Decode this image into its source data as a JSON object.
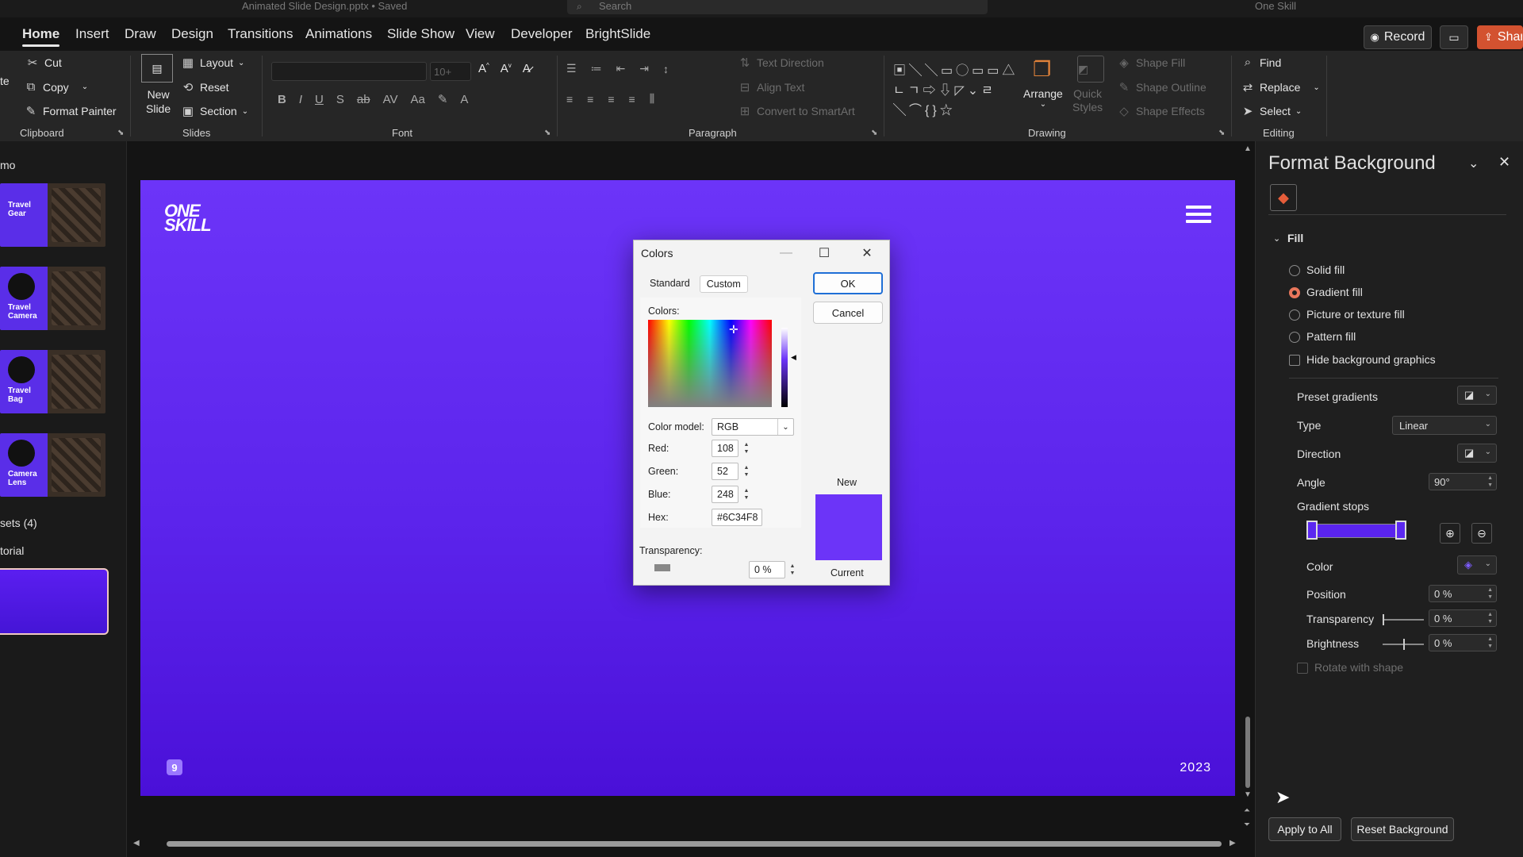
{
  "titlebar": {
    "doc_title": "Animated Slide Design.pptx • Saved",
    "search_placeholder": "Search",
    "user_name": "One Skill"
  },
  "tabs": [
    {
      "label": "Home",
      "active": true
    },
    {
      "label": "Insert"
    },
    {
      "label": "Draw"
    },
    {
      "label": "Design"
    },
    {
      "label": "Transitions"
    },
    {
      "label": "Animations"
    },
    {
      "label": "Slide Show"
    },
    {
      "label": "View"
    },
    {
      "label": "Developer"
    },
    {
      "label": "BrightSlide"
    }
  ],
  "header_actions": {
    "record": "Record",
    "share": "Share"
  },
  "ribbon": {
    "clipboard": {
      "paste": "te",
      "cut": "Cut",
      "copy": "Copy",
      "format_painter": "Format Painter",
      "label": "Clipboard"
    },
    "slides": {
      "new_slide_line1": "New",
      "new_slide_line2": "Slide",
      "layout": "Layout",
      "reset": "Reset",
      "section": "Section",
      "label": "Slides"
    },
    "font": {
      "size": "10+",
      "label": "Font"
    },
    "paragraph": {
      "text_direction": "Text Direction",
      "align_text": "Align Text",
      "smartart": "Convert to SmartArt",
      "label": "Paragraph"
    },
    "drawing": {
      "arrange": "Arrange",
      "quick_styles_line1": "Quick",
      "quick_styles_line2": "Styles",
      "shape_fill": "Shape Fill",
      "shape_outline": "Shape Outline",
      "shape_effects": "Shape Effects",
      "label": "Drawing"
    },
    "editing": {
      "find": "Find",
      "replace": "Replace",
      "select": "Select",
      "label": "Editing"
    }
  },
  "left_panel": {
    "section_demo": "mo",
    "section_assets": "sets (4)",
    "section_tutorial": "torial",
    "thumbs": [
      {
        "title": "Travel Gear"
      },
      {
        "title": "Travel Camera"
      },
      {
        "title": "Travel Bag"
      },
      {
        "title": "Camera Lens"
      }
    ]
  },
  "slide": {
    "logo_line1": "ONE",
    "logo_line2": "SKILL",
    "page_number": "9",
    "year": "2023",
    "bg_color": "#6C34F8"
  },
  "colors_dialog": {
    "title": "Colors",
    "tab_standard": "Standard",
    "tab_custom": "Custom",
    "ok": "OK",
    "cancel": "Cancel",
    "colors_label": "Colors:",
    "color_model_label": "Color model:",
    "color_model_value": "RGB",
    "red_label": "Red:",
    "red_value": "108",
    "green_label": "Green:",
    "green_value": "52",
    "blue_label": "Blue:",
    "blue_value": "248",
    "hex_label": "Hex:",
    "hex_value": "#6C34F8",
    "transparency_label": "Transparency:",
    "transparency_value": "0 %",
    "new_label": "New",
    "current_label": "Current"
  },
  "format_pane": {
    "title": "Format Background",
    "fill_header": "Fill",
    "solid_fill": "Solid fill",
    "gradient_fill": "Gradient fill",
    "picture_fill": "Picture or texture fill",
    "pattern_fill": "Pattern fill",
    "hide_graphics": "Hide background graphics",
    "preset_gradients": "Preset gradients",
    "type_label": "Type",
    "type_value": "Linear",
    "direction_label": "Direction",
    "angle_label": "Angle",
    "angle_value": "90°",
    "gradient_stops": "Gradient stops",
    "color_label": "Color",
    "position_label": "Position",
    "position_value": "0 %",
    "transparency_label": "Transparency",
    "transparency_value": "0 %",
    "brightness_label": "Brightness",
    "brightness_value": "0 %",
    "rotate_with_shape": "Rotate with shape",
    "apply_to_all": "Apply to All",
    "reset_background": "Reset Background"
  }
}
